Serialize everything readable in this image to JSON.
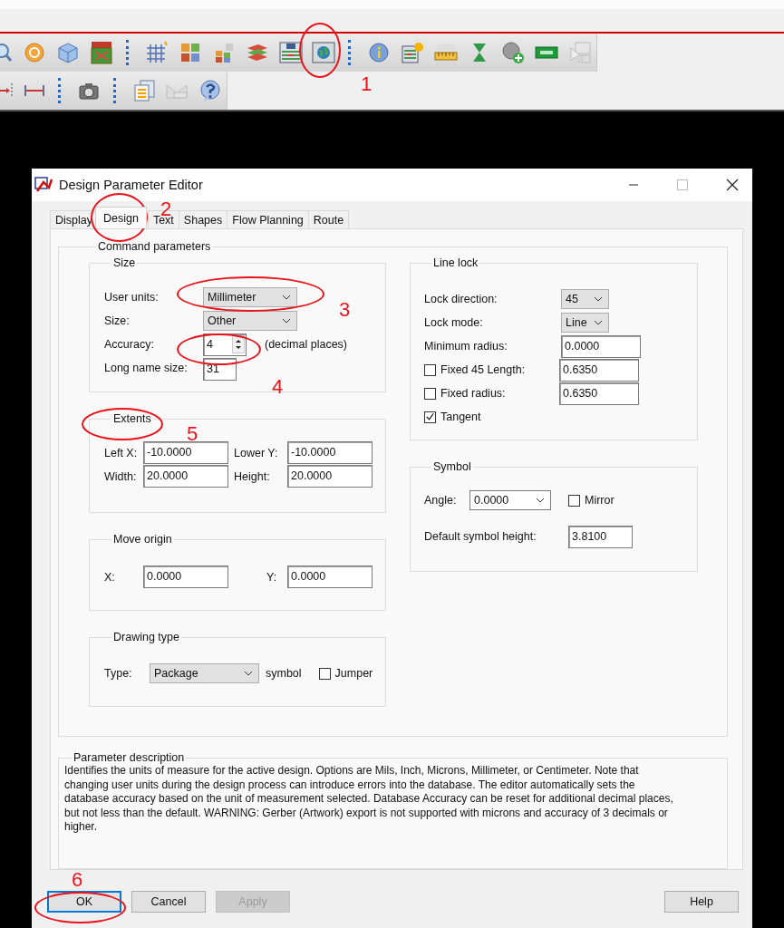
{
  "window": {
    "title": "Design Parameter Editor"
  },
  "tabs": [
    {
      "label": "Display",
      "selected": false
    },
    {
      "label": "Design",
      "selected": true
    },
    {
      "label": "Text",
      "selected": false
    },
    {
      "label": "Shapes",
      "selected": false
    },
    {
      "label": "Flow Planning",
      "selected": false
    },
    {
      "label": "Route",
      "selected": false
    }
  ],
  "command_parameters": {
    "title": "Command parameters",
    "size": {
      "title": "Size",
      "user_units": {
        "label": "User units:",
        "value": "Millimeter"
      },
      "size": {
        "label": "Size:",
        "value": "Other"
      },
      "accuracy": {
        "label": "Accuracy:",
        "value": "4",
        "suffix": "(decimal places)"
      },
      "long_name_size": {
        "label": "Long name size:",
        "value": "31"
      }
    },
    "extents": {
      "title": "Extents",
      "fields": [
        {
          "label": "Left X:",
          "value": "-10.0000"
        },
        {
          "label": "Lower Y:",
          "value": "-10.0000"
        },
        {
          "label": "Width:",
          "value": "20.0000"
        },
        {
          "label": "Height:",
          "value": "20.0000"
        }
      ]
    },
    "move_origin": {
      "title": "Move origin",
      "fields": [
        {
          "label": "X:",
          "value": "0.0000"
        },
        {
          "label": "Y:",
          "value": "0.0000"
        }
      ]
    },
    "drawing_type": {
      "title": "Drawing type",
      "type_label": "Type:",
      "type_value": "Package",
      "suffix": "symbol",
      "jumper": {
        "label": "Jumper",
        "checked": false
      }
    },
    "line_lock": {
      "title": "Line lock",
      "rows": [
        {
          "kind": "dropdown",
          "label": "Lock direction:",
          "value": "45"
        },
        {
          "kind": "dropdown",
          "label": "Lock mode:",
          "value": "Line"
        },
        {
          "kind": "field",
          "label": "Minimum radius:",
          "value": "0.0000"
        },
        {
          "kind": "check-field",
          "label": "Fixed 45 Length:",
          "checked": false,
          "value": "0.6350"
        },
        {
          "kind": "check-field",
          "label": "Fixed radius:",
          "checked": false,
          "value": "0.6350"
        },
        {
          "kind": "check",
          "label": "Tangent",
          "checked": true
        }
      ]
    },
    "symbol": {
      "title": "Symbol",
      "angle": {
        "label": "Angle:",
        "value": "0.0000"
      },
      "mirror": {
        "label": "Mirror",
        "checked": false
      },
      "height": {
        "label": "Default symbol height:",
        "value": "3.8100"
      }
    }
  },
  "parameter_description": {
    "title": "Parameter description",
    "text": "Identifies the units of measure for the active design. Options are Mils, Inch, Microns, Millimeter, or Centimeter. Note that changing user units during the design process can introduce errors into the database.  The editor automatically sets the database accuracy based on the unit of measurement selected. Database Accuracy can be reset for additional decimal places, but not less than the default. WARNING: Gerber (Artwork) export is not supported with microns and accuracy of 3 decimals or higher."
  },
  "buttons": [
    {
      "label": "OK",
      "disabled": false,
      "default": true
    },
    {
      "label": "Cancel",
      "disabled": false,
      "default": false
    },
    {
      "label": "Apply",
      "disabled": true,
      "default": false
    },
    {
      "label": "Help",
      "disabled": false,
      "default": false
    }
  ],
  "annotations": [
    "1",
    "2",
    "3",
    "4",
    "5",
    "6"
  ]
}
